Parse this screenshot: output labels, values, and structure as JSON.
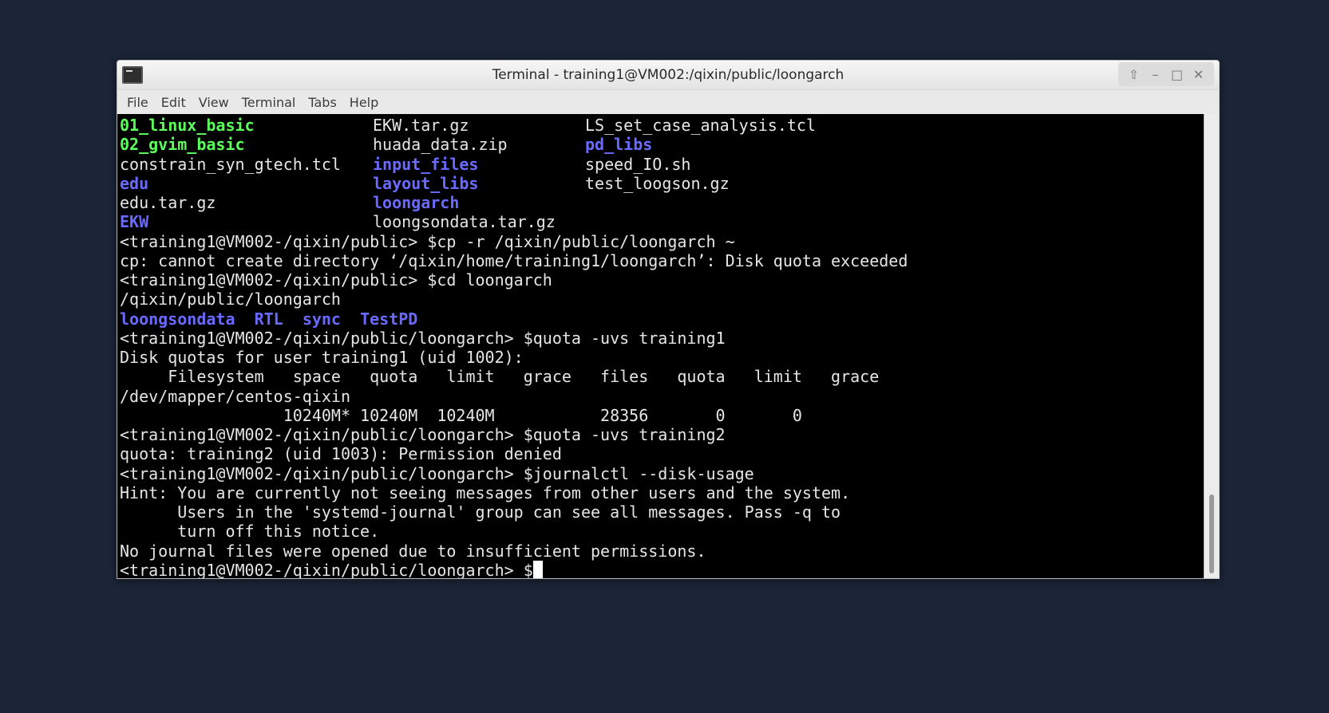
{
  "window": {
    "title": "Terminal - training1@VM002:/qixin/public/loongarch",
    "controls": [
      "up-icon",
      "minimize-icon",
      "maximize-icon",
      "close-icon"
    ]
  },
  "menubar": {
    "items": [
      "File",
      "Edit",
      "View",
      "Terminal",
      "Tabs",
      "Help"
    ]
  },
  "terminal": {
    "ls_rows": [
      {
        "col1": {
          "text": "01_linux_basic",
          "type": "exe"
        },
        "col2": {
          "text": "EKW.tar.gz",
          "type": "file"
        },
        "col3": {
          "text": "LS_set_case_analysis.tcl",
          "type": "file"
        }
      },
      {
        "col1": {
          "text": "02_gvim_basic",
          "type": "exe"
        },
        "col2": {
          "text": "huada_data.zip",
          "type": "file"
        },
        "col3": {
          "text": "pd_libs",
          "type": "dir"
        }
      },
      {
        "col1": {
          "text": "constrain_syn_gtech.tcl",
          "type": "file"
        },
        "col2": {
          "text": "input_files",
          "type": "dir"
        },
        "col3": {
          "text": "speed_IO.sh",
          "type": "file"
        }
      },
      {
        "col1": {
          "text": "edu",
          "type": "dir"
        },
        "col2": {
          "text": "layout_libs",
          "type": "dir"
        },
        "col3": {
          "text": "test_loogson.gz",
          "type": "file"
        }
      },
      {
        "col1": {
          "text": "edu.tar.gz",
          "type": "file"
        },
        "col2": {
          "text": "loongarch",
          "type": "dir"
        },
        "col3": {
          "text": "",
          "type": "file"
        }
      },
      {
        "col1": {
          "text": "EKW",
          "type": "dir"
        },
        "col2": {
          "text": "loongsondata.tar.gz",
          "type": "file"
        },
        "col3": {
          "text": "",
          "type": "file"
        }
      }
    ],
    "lines": [
      "<training1@VM002-/qixin/public> $cp -r /qixin/public/loongarch ~",
      "cp: cannot create directory ‘/qixin/home/training1/loongarch’: Disk quota exceeded",
      "<training1@VM002-/qixin/public> $cd loongarch",
      "/qixin/public/loongarch"
    ],
    "ls_dirs": [
      "loongsondata",
      "RTL",
      "sync",
      "TestPD"
    ],
    "lines2": [
      "<training1@VM002-/qixin/public/loongarch> $quota -uvs training1",
      "Disk quotas for user training1 (uid 1002):",
      "     Filesystem   space   quota   limit   grace   files   quota   limit   grace",
      "/dev/mapper/centos-qixin",
      "                 10240M* 10240M  10240M           28356       0       0",
      "<training1@VM002-/qixin/public/loongarch> $quota -uvs training2",
      "quota: training2 (uid 1003): Permission denied",
      "<training1@VM002-/qixin/public/loongarch> $journalctl --disk-usage",
      "Hint: You are currently not seeing messages from other users and the system.",
      "      Users in the 'systemd-journal' group can see all messages. Pass -q to",
      "      turn off this notice.",
      "No journal files were opened due to insufficient permissions."
    ],
    "prompt": "<training1@VM002-/qixin/public/loongarch> $"
  },
  "scrollbar": {
    "thumb_start_fraction": 0.82,
    "thumb_end_fraction": 0.99
  }
}
